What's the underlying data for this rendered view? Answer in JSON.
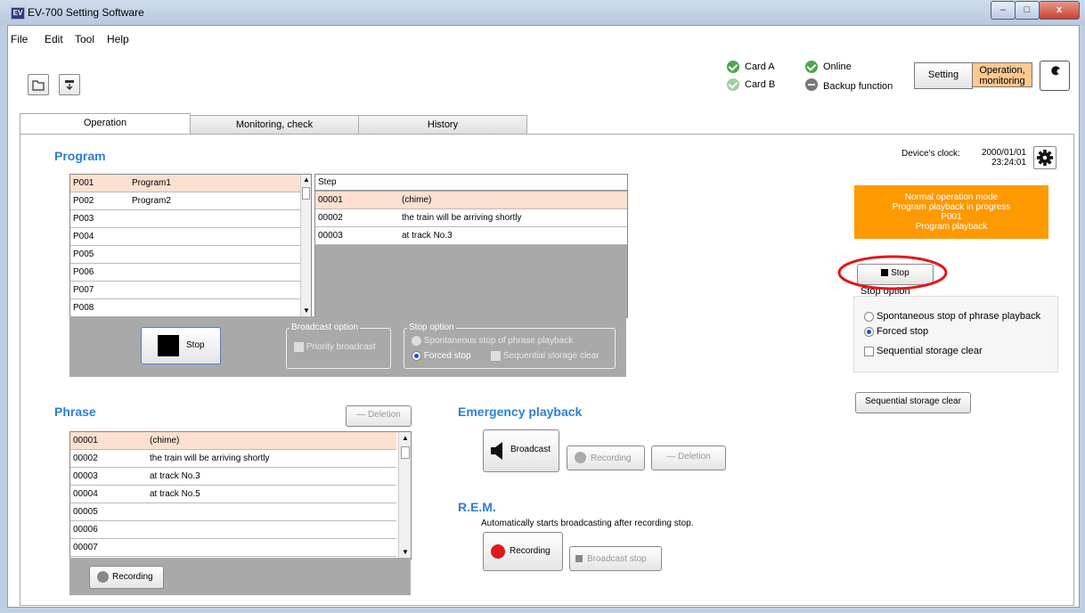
{
  "window": {
    "title": "EV-700 Setting Software",
    "app_icon": "EV",
    "min": "‒",
    "max": "□",
    "close": "x"
  },
  "menu": [
    "File",
    "Edit",
    "Tool",
    "Help"
  ],
  "status": {
    "card_a": "Card A",
    "card_b": "Card B",
    "online": "Online",
    "backup": "Backup function"
  },
  "mode": {
    "setting": "Setting",
    "operation": "Operation,\nmonitoring"
  },
  "tabs": [
    "Operation",
    "Monitoring, check",
    "History"
  ],
  "program": {
    "heading": "Program",
    "list": [
      {
        "id": "P001",
        "name": "Program1"
      },
      {
        "id": "P002",
        "name": "Program2"
      },
      {
        "id": "P003",
        "name": ""
      },
      {
        "id": "P004",
        "name": ""
      },
      {
        "id": "P005",
        "name": ""
      },
      {
        "id": "P006",
        "name": ""
      },
      {
        "id": "P007",
        "name": ""
      },
      {
        "id": "P008",
        "name": ""
      }
    ],
    "step_header": "Step",
    "steps": [
      {
        "id": "00001",
        "text": "(chime)"
      },
      {
        "id": "00002",
        "text": "the train will be arriving shortly"
      },
      {
        "id": "00003",
        "text": "at track No.3"
      }
    ],
    "stop_button": "Stop",
    "broadcast_option_title": "Broadcast option",
    "priority_broadcast": "Priority broadcast",
    "stop_option_title": "Stop option",
    "spontaneous_stop": "Spontaneous stop of phrase playback",
    "forced_stop": "Forced stop",
    "sequential_clear": "Sequential storage clear"
  },
  "clock": {
    "label": "Device's clock:",
    "date": "2000/01/01",
    "time": "23:24:01"
  },
  "mode_banner": [
    "Normal operation mode",
    "Program playback in progress",
    "P001",
    "Program playback"
  ],
  "right_panel": {
    "stop_button": "Stop",
    "stop_option_title": "Stop option",
    "spontaneous_stop": "Spontaneous stop of phrase playback",
    "forced_stop": "Forced stop",
    "sequential_clear": "Sequential storage clear",
    "sequential_clear_button": "Sequential storage clear"
  },
  "phrase": {
    "heading": "Phrase",
    "deletion": "Deletion",
    "rows": [
      {
        "id": "00001",
        "text": "(chime)"
      },
      {
        "id": "00002",
        "text": "the train will be arriving shortly"
      },
      {
        "id": "00003",
        "text": "at track No.3"
      },
      {
        "id": "00004",
        "text": "at track No.5"
      },
      {
        "id": "00005",
        "text": ""
      },
      {
        "id": "00006",
        "text": ""
      },
      {
        "id": "00007",
        "text": ""
      }
    ],
    "recording": "Recording"
  },
  "emergency": {
    "heading": "Emergency playback",
    "broadcast": "Broadcast",
    "recording": "Recording",
    "deletion": "Deletion"
  },
  "rem": {
    "heading": "R.E.M.",
    "desc": "Automatically starts broadcasting after recording stop.",
    "recording": "Recording",
    "broadcast_stop": "Broadcast stop"
  },
  "colors": {
    "accent_orange": "#ff9900",
    "heading_blue": "#2b7fd4",
    "selected_row": "#fde0cf",
    "highlight_ring": "#e0191c"
  }
}
